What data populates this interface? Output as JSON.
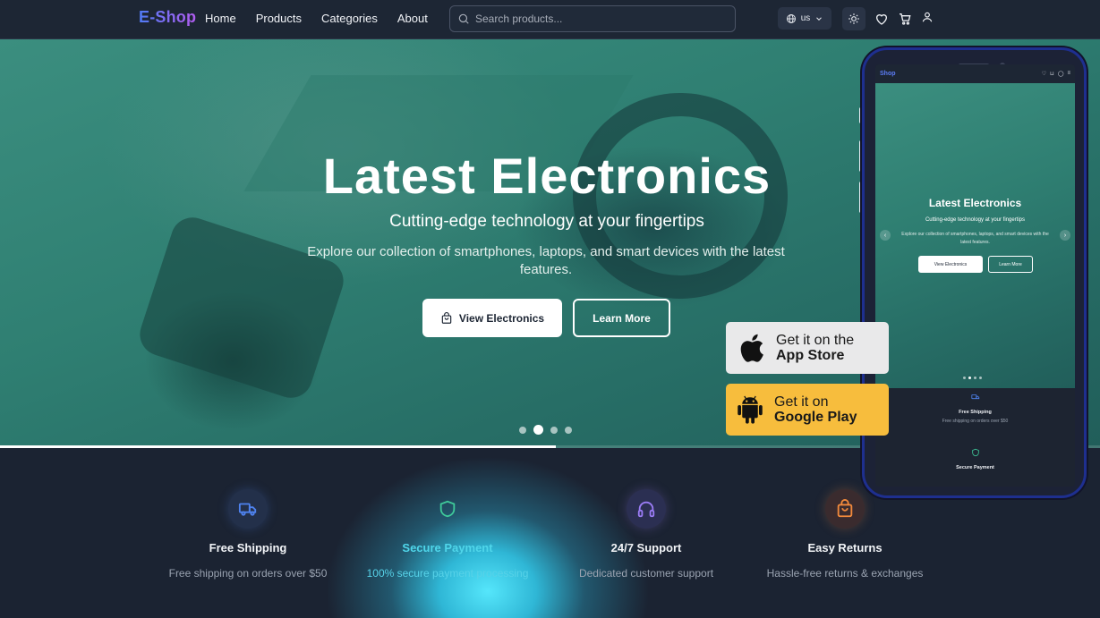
{
  "nav": {
    "logo": "E-Shop",
    "links": [
      "Home",
      "Products",
      "Categories",
      "About"
    ],
    "search_placeholder": "Search products...",
    "language": "us",
    "icons": [
      "globe-icon",
      "chevron-down-icon",
      "sun-icon",
      "heart-icon",
      "cart-icon",
      "user-icon"
    ]
  },
  "hero": {
    "title": "Latest Electronics",
    "subtitle": "Cutting-edge technology at your fingertips",
    "description": "Explore our collection of smartphones, laptops, and smart devices with the latest features.",
    "primary_button": "View Electronics",
    "secondary_button": "Learn More",
    "slide_count": 4,
    "active_slide": 2,
    "progress_fraction": 0.505
  },
  "features": [
    {
      "title": "Free Shipping",
      "description": "Free shipping on orders over $50",
      "icon": "truck-icon",
      "color": "#4f83f0"
    },
    {
      "title": "Secure Payment",
      "description": "100% secure payment processing",
      "icon": "shield-icon",
      "color": "#3fc99a"
    },
    {
      "title": "24/7 Support",
      "description": "Dedicated customer support",
      "icon": "headphones-icon",
      "color": "#9a7cf5"
    },
    {
      "title": "Easy Returns",
      "description": "Hassle-free returns & exchanges",
      "icon": "shopping-bag-icon",
      "color": "#f28a3c"
    }
  ],
  "app_badges": {
    "apple": {
      "line1": "Get it on the",
      "line2": "App Store"
    },
    "google": {
      "line1": "Get it on",
      "line2": "Google Play"
    }
  },
  "phone_preview": {
    "logo": "Shop",
    "title": "Latest Electronics",
    "subtitle": "Cutting-edge technology at your fingertips",
    "description": "Explore our collection of smartphones, laptops, and smart devices with the latest features.",
    "primary_button": "View Electronics",
    "secondary_button": "Learn More",
    "features": [
      {
        "title": "Free Shipping",
        "description": "Free shipping on orders over $50"
      },
      {
        "title": "Secure Payment",
        "description": ""
      }
    ]
  },
  "colors": {
    "nav_bg": "#1d2634",
    "hero_teal": "#2f7f72",
    "page_bg": "#1b2332",
    "glow_cyan": "#55e6fb",
    "google_badge": "#f7bd3d",
    "apple_badge": "#e9e9ea"
  }
}
